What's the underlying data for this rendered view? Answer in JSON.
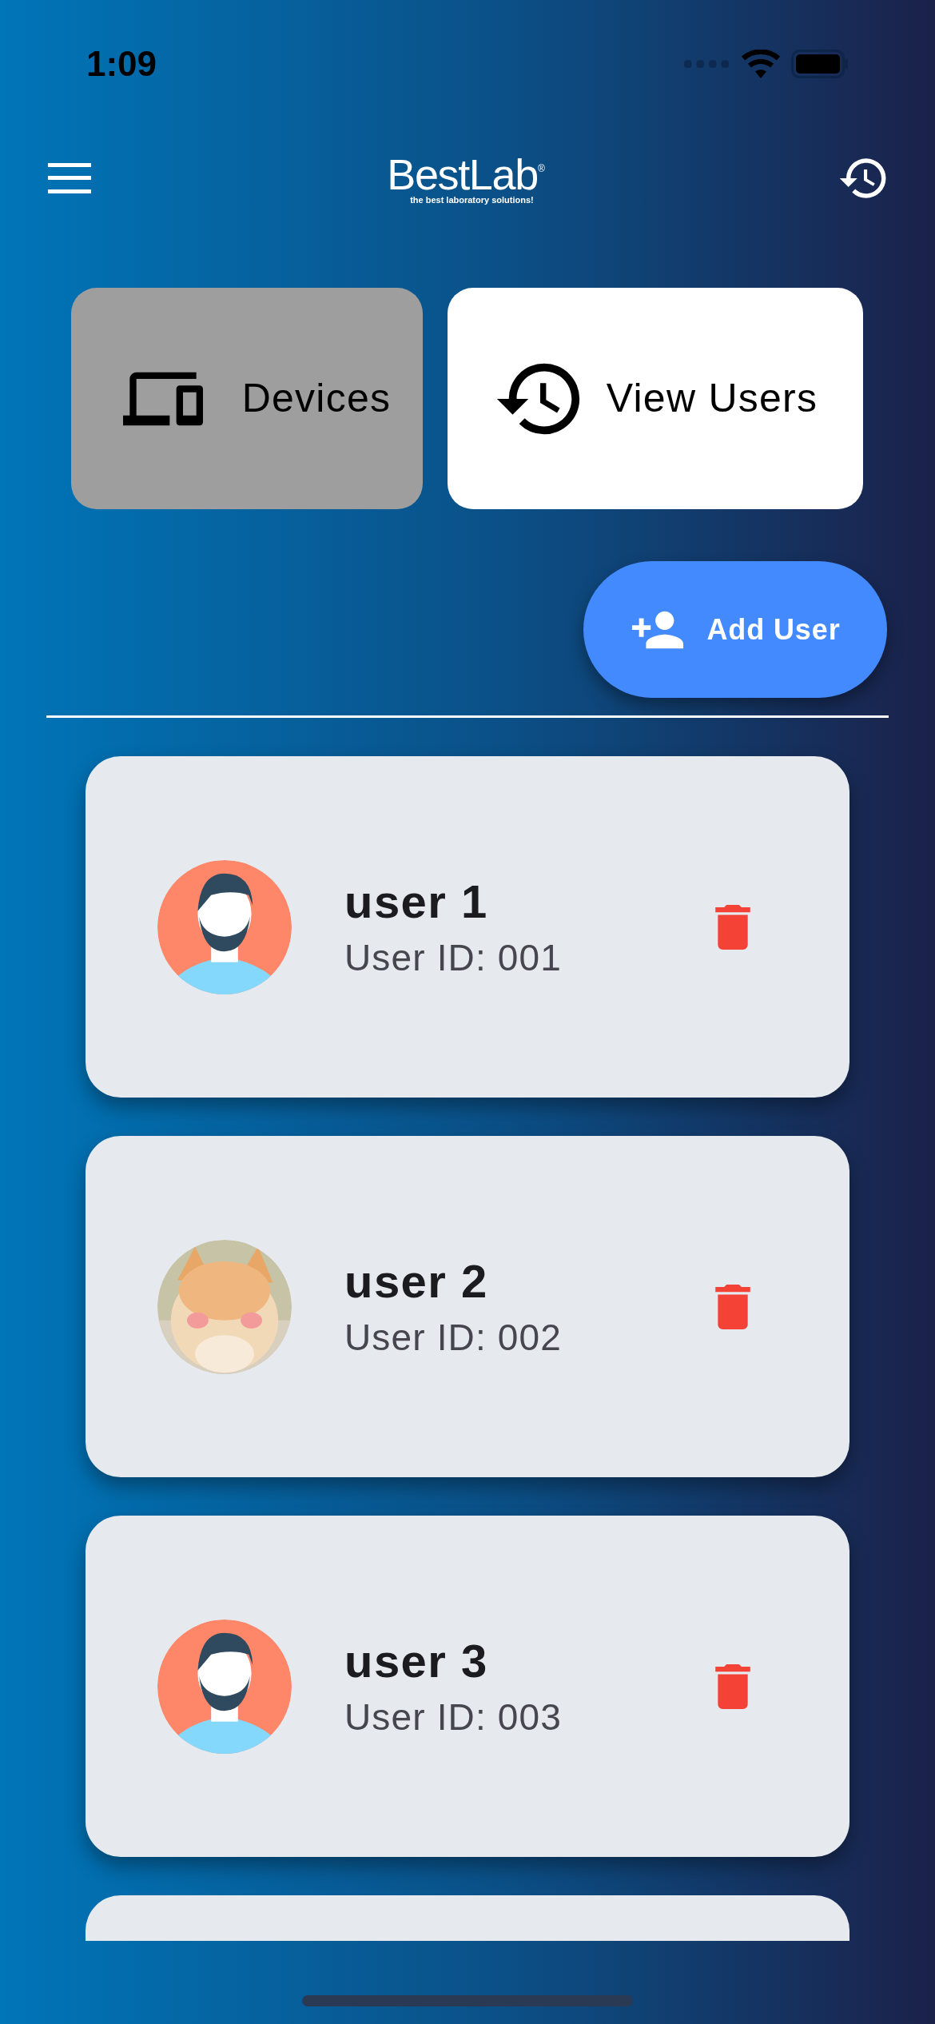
{
  "status_bar": {
    "time": "1:09"
  },
  "header": {
    "logo": {
      "name": "BestLab",
      "registered": "®",
      "tagline": "the best laboratory solutions!"
    }
  },
  "tabs": [
    {
      "label": "Devices",
      "selected": true
    },
    {
      "label": "View Users",
      "selected": false
    }
  ],
  "add_button": {
    "label": "Add User"
  },
  "users": [
    {
      "kind": "user",
      "name": "user 1",
      "user_id": "User ID: 001",
      "avatar": {
        "kind": "illustration"
      }
    },
    {
      "kind": "user",
      "name": "user 2",
      "user_id": "User ID: 002"
    },
    {
      "kind": "user",
      "name": "user 3",
      "user_id": "User ID: 003",
      "avatar": {
        "kind": "illustration"
      }
    },
    {
      "kind": "cut_off"
    }
  ]
}
